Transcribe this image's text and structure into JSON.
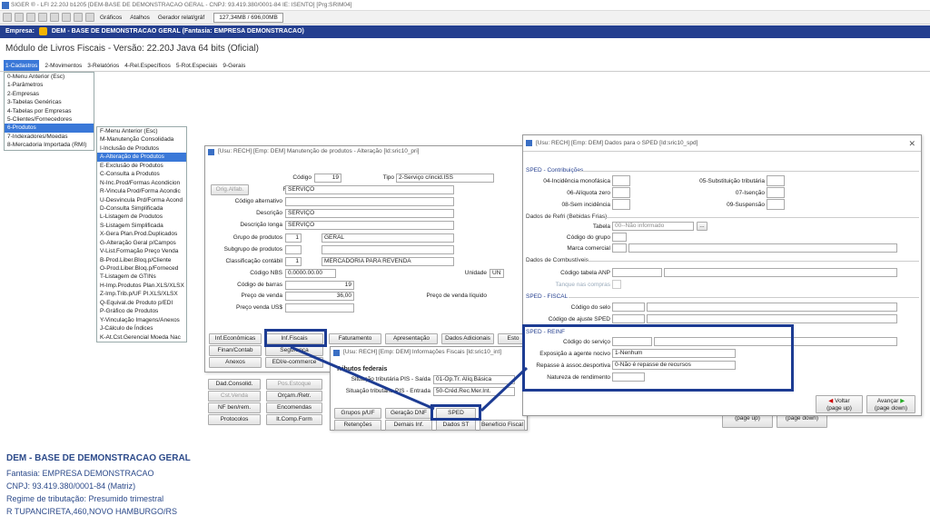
{
  "window_title": "SIGER ® - LFI 22.20J b1205 [DEM-BASE DE DEMONSTRACAO GERAL - CNPJ: 93.419.380/0001-84 IE: ISENTO] [Prg:SRIM04]",
  "toolbar": {
    "graficos": "Gráficos",
    "atalhos": "Atalhos",
    "gerador": "Gerador relat/gráf",
    "memory": "127,34MB / 696,00MB"
  },
  "empresa": {
    "label": "Empresa:",
    "value": "DEM - BASE DE DEMONSTRACAO GERAL (Fantasia: EMPRESA DEMONSTRACAO)"
  },
  "module_title": "Módulo de Livros Fiscais - Versão: 22.20J Java 64 bits (Oficial)",
  "menubar": [
    "1-Cadastros",
    "2-Movimentos",
    "3-Relatórios",
    "4-Rel.Específicos",
    "5-Rot.Especiais",
    "9-Gerais"
  ],
  "dropdown": [
    "0-Menu Anterior (Esc)",
    "1-Parâmetros",
    "2-Empresas",
    "3-Tabelas Genéricas",
    "4-Tabelas por Empresas",
    "5-Clientes/Fornecedores",
    "6-Produtos",
    "7-Indexadores/Moedas",
    "8-Mercadoria Importada (RMI)"
  ],
  "submenu": [
    "F-Menu Anterior (Esc)",
    "M-Manutenção Consolidada",
    "I-Inclusão de Produtos",
    "A-Alteração de Produtos",
    "E-Exclusão de Produtos",
    "C-Consulta a Produtos",
    "N-Inc.Prod/Formas Acondicion",
    "R-Vincula Prod/Forma Acondic",
    "U-Desvincula Prd/Forma Acond",
    "D-Consulta Simplificada",
    "L-Listagem de Produtos",
    "S-Listagem Simplificada",
    "X-Gera Plan.Prod.Duplicados",
    "G-Alteração Geral p/Campos",
    "V-List.Formação Preço Venda",
    "B-Prod.Liber.Bloq.p/Cliente",
    "O-Prod.Liber.Bloq.p/Forneced",
    "T-Listagem de GTINs",
    "H-Imp.Produtos Plan.XLS/XLSX",
    "Z-Imp.Trib.p/UF Pl.XLS/XLSX",
    "Q-Equival.de Produto p/EDI",
    "P-Gráfico de Produtos",
    "Y-Vinculação Imagens/Anexos",
    "J-Cálculo de Índices",
    "K-At.Cst.Gerencial Moeda Nac"
  ],
  "prod_win": {
    "title": "[Usu: RECH] [Emp: DEM] Manutenção de produtos - Alteração [Id:sric10_pri]",
    "codigo_label": "Código",
    "codigo": "19",
    "tipo_label": "Tipo",
    "tipo": "2-Serviço c/incid.ISS",
    "orig_btn": "Orig.Alfab.",
    "referencia_label": "Referência",
    "referencia": "SERVIÇO",
    "cod_alt_label": "Código alternativo",
    "descricao_label": "Descrição",
    "descricao": "SERVIÇO",
    "desc_longa_label": "Descrição longa",
    "desc_longa": "SERVIÇO",
    "grupo_label": "Grupo de produtos",
    "grupo_num": "1",
    "grupo": "GERAL",
    "subgrupo_label": "Subgrupo de produtos",
    "class_label": "Classificação contábil",
    "class_num": "1",
    "class": "MERCADORIA PARA REVENDA",
    "ncm_label": "Código NBS",
    "ncm": "0.0000.00.00",
    "unidade_label": "Unidade",
    "unidade": "UN",
    "barras_label": "Código de barras",
    "barras": "19",
    "preco_label": "Preço de venda",
    "preco": "36,00",
    "preco_liq_label": "Preço de venda líquido",
    "preco_us_label": "Preço venda US$",
    "btn_row1": [
      "Inf.Econômicas",
      "Inf.Fiscais",
      "Faturamento",
      "Apresentação",
      "Dados Adicionais",
      "Esto"
    ],
    "btn_row2": [
      "Finan/Contab",
      "Segurança"
    ],
    "btn_row3": [
      "Anexos",
      "EDI/e-commerce"
    ],
    "side_left": [
      "Dad.Consolid.",
      "Cst.Venda",
      "NF ben/rem.",
      "Protocolos"
    ],
    "side_right": [
      "Pos.Estoque",
      "Orçam./Retr.",
      "Encomendas",
      "It.Comp.Form"
    ]
  },
  "fiscal_win": {
    "title": "[Usu: RECH] [Emp: DEM] Informações Fiscais [Id:sric10_int]",
    "section": "Tributos federais",
    "pis_saida_label": "Situação tributária PIS - Saída",
    "pis_saida": "01-Op.Tr. Alíq.Básica",
    "pis_entrada_label": "Situação tributária PIS - Entrada",
    "pis_entrada": "50-Créd.Rec.Mer.Int.",
    "btns_row1": [
      "Grupos p/UF",
      "Geração DNF",
      "SPED"
    ],
    "btns_row2": [
      "Retenções",
      "Demais Inf.",
      "Dados ST",
      "Benefício Fiscal"
    ]
  },
  "sped_win": {
    "title": "[Usu: RECH] [Emp: DEM] Dados para o SPED [Id:sric10_spd]",
    "close": "✕",
    "contrib": "SPED - Contribuições",
    "f04": "04-Incidência monofásica",
    "f05": "05-Substituição tributária",
    "f06": "06-Alíquota zero",
    "f07": "07-Isenção",
    "f08": "08-Sem incidência",
    "f09": "09-Suspensão",
    "bebidas": "Dados de Refri (Bebidas Frias)",
    "tabela_label": "Tabela",
    "tabela": "00--Não informado",
    "ellipsis": "...",
    "cod_grupo_label": "Código do grupo",
    "marca_label": "Marca comercial",
    "combust": "Dados de Combustíveis",
    "anp_label": "Código tabela ANP",
    "tanque_label": "Tanque nas compras",
    "fiscal": "SPED - FISCAL",
    "selo_label": "Código do selo",
    "ajuste_label": "Código de ajuste SPED",
    "reinf": "SPED - REINF",
    "servico_label": "Código do serviço",
    "exposicao_label": "Exposição a agente nocivo",
    "exposicao": "1-Nenhum",
    "repasse_label": "Repasse à assoc.desportiva",
    "repasse": "0-Não é repasse de recursos",
    "natureza_label": "Natureza de rendimento",
    "voltar": "Voltar",
    "voltar_sub": "(page up)",
    "avancar": "Avançar",
    "avancar_sub": "(page down)"
  },
  "behind_btns": [
    "(page up)",
    "(page down)"
  ],
  "footer": {
    "name": "DEM - BASE DE DEMONSTRACAO GERAL",
    "fantasia": "Fantasia: EMPRESA DEMONSTRACAO",
    "cnpj": "CNPJ: 93.419.380/0001-84 (Matriz)",
    "regime": "Regime de tributação: Presumido trimestral",
    "endereco": "R TUPANCIRETA,460,NOVO HAMBURGO/RS"
  },
  "colors": {
    "accent": "#1d3c93",
    "menu_sel": "#3a78d8",
    "header": "#243f8f"
  }
}
